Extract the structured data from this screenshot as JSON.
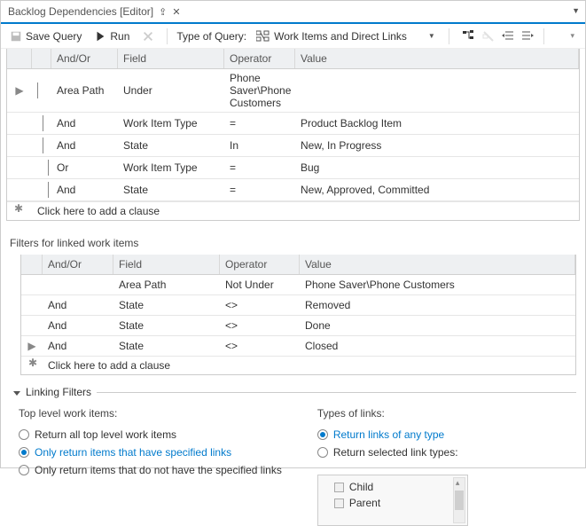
{
  "tab": {
    "title": "Backlog Dependencies [Editor]"
  },
  "toolbar": {
    "save": "Save Query",
    "run": "Run",
    "type_label": "Type of Query:",
    "type_value": "Work Items and Direct Links"
  },
  "grid1": {
    "headers": {
      "andor": "And/Or",
      "field": "Field",
      "operator": "Operator",
      "value": "Value"
    },
    "rows": [
      {
        "mark": "▶",
        "indent": 0,
        "andor": "",
        "field": "Area Path",
        "op": "Under",
        "val": "Phone Saver\\Phone Customers"
      },
      {
        "mark": "",
        "indent": 1,
        "andor": "And",
        "field": "Work Item Type",
        "op": "=",
        "val": "Product Backlog Item"
      },
      {
        "mark": "",
        "indent": 1,
        "andor": "And",
        "field": "State",
        "op": "In",
        "val": "New, In Progress"
      },
      {
        "mark": "",
        "indent": 2,
        "andor": "Or",
        "field": "Work Item Type",
        "op": "=",
        "val": "Bug"
      },
      {
        "mark": "",
        "indent": 2,
        "andor": "And",
        "field": "State",
        "op": "=",
        "val": "New, Approved, Committed"
      }
    ],
    "add": "Click here to add a clause"
  },
  "section2_title": "Filters for linked work items",
  "grid2": {
    "headers": {
      "andor": "And/Or",
      "field": "Field",
      "operator": "Operator",
      "value": "Value"
    },
    "rows": [
      {
        "mark": "",
        "andor": "",
        "field": "Area Path",
        "op": "Not Under",
        "val": "Phone Saver\\Phone Customers"
      },
      {
        "mark": "",
        "andor": "And",
        "field": "State",
        "op": "<>",
        "val": "Removed"
      },
      {
        "mark": "",
        "andor": "And",
        "field": "State",
        "op": "<>",
        "val": "Done"
      },
      {
        "mark": "▶",
        "andor": "And",
        "field": "State",
        "op": "<>",
        "val": "Closed"
      }
    ],
    "add": "Click here to add a clause"
  },
  "linking": {
    "title": "Linking Filters",
    "left_title": "Top level work items:",
    "left": [
      "Return all top level work items",
      "Only return items that have specified links",
      "Only return items that do not have the specified links"
    ],
    "left_selected": 1,
    "right_title": "Types of links:",
    "right": [
      "Return links of any type",
      "Return selected link types:"
    ],
    "right_selected": 0,
    "link_types": [
      "Child",
      "Parent"
    ]
  }
}
